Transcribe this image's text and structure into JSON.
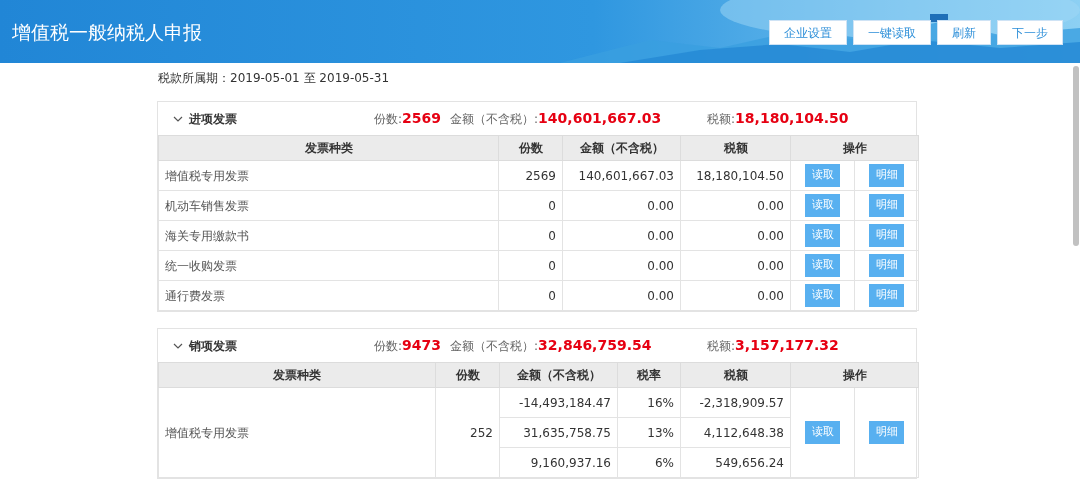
{
  "header": {
    "title": "增值税一般纳税人申报",
    "buttons": [
      "企业设置",
      "一键读取",
      "刷新",
      "下一步"
    ]
  },
  "period": "税款所属期：2019-05-01 至 2019-05-31",
  "sections": [
    {
      "title": "进项发票",
      "expanded": true,
      "count_label": "份数:",
      "count": "2569",
      "amount_label": "金额（不含税）:",
      "amount": "140,601,667.03",
      "tax_label": "税额:",
      "tax": "18,180,104.50",
      "columns": [
        "发票种类",
        "份数",
        "金额（不含税）",
        "税额",
        "操作"
      ],
      "rows": [
        {
          "type": "增值税专用发票",
          "count": "2569",
          "lines": [
            {
              "amount": "140,601,667.03",
              "tax": "18,180,104.50"
            }
          ],
          "actions": [
            "读取",
            "明细"
          ]
        },
        {
          "type": "机动车销售发票",
          "count": "0",
          "lines": [
            {
              "amount": "0.00",
              "tax": "0.00"
            }
          ],
          "actions": [
            "读取",
            "明细"
          ]
        },
        {
          "type": "海关专用缴款书",
          "count": "0",
          "lines": [
            {
              "amount": "0.00",
              "tax": "0.00"
            }
          ],
          "actions": [
            "读取",
            "明细"
          ]
        },
        {
          "type": "统一收购发票",
          "count": "0",
          "lines": [
            {
              "amount": "0.00",
              "tax": "0.00"
            }
          ],
          "actions": [
            "读取",
            "明细"
          ]
        },
        {
          "type": "通行费发票",
          "count": "0",
          "lines": [
            {
              "amount": "0.00",
              "tax": "0.00"
            }
          ],
          "actions": [
            "读取",
            "明细"
          ]
        }
      ]
    },
    {
      "title": "销项发票",
      "expanded": true,
      "count_label": "份数:",
      "count": "9473",
      "amount_label": "金额（不含税）:",
      "amount": "32,846,759.54",
      "tax_label": "税额:",
      "tax": "3,157,177.32",
      "columns": [
        "发票种类",
        "份数",
        "金额（不含税）",
        "税率",
        "税额",
        "操作"
      ],
      "rows": [
        {
          "type": "增值税专用发票",
          "count": "252",
          "lines": [
            {
              "amount": "-14,493,184.47",
              "rate": "16%",
              "tax": "-2,318,909.57"
            },
            {
              "amount": "31,635,758.75",
              "rate": "13%",
              "tax": "4,112,648.38"
            },
            {
              "amount": "9,160,937.16",
              "rate": "6%",
              "tax": "549,656.24"
            }
          ],
          "actions": [
            "读取",
            "明细"
          ]
        }
      ]
    }
  ]
}
